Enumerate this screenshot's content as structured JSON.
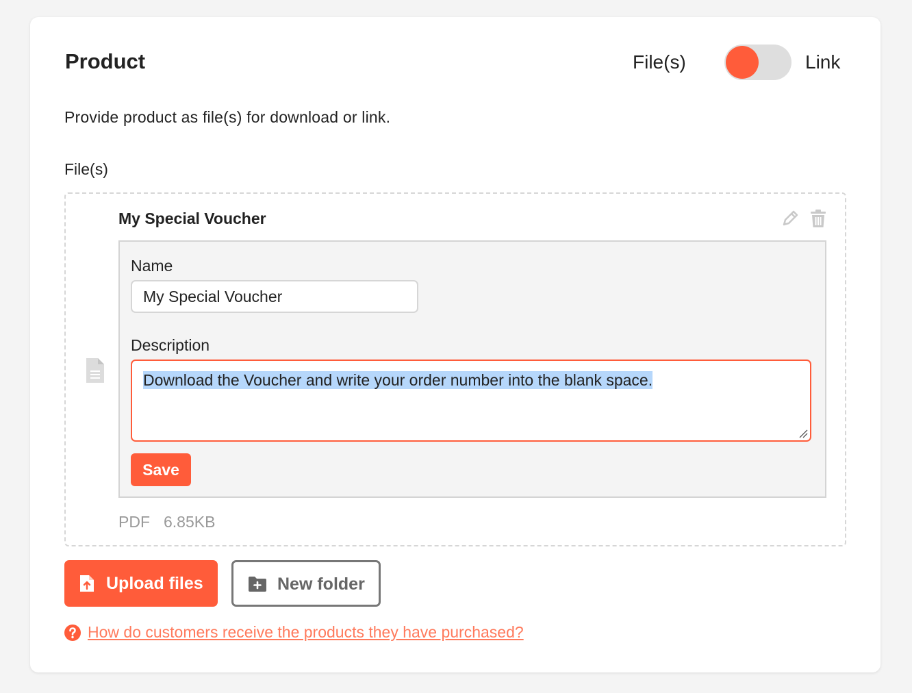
{
  "section": {
    "title": "Product",
    "description": "Provide product as file(s) for download or link.",
    "toggle": {
      "left_label": "File(s)",
      "right_label": "Link",
      "selected": "File(s)",
      "accent_color": "#ff5c3a"
    },
    "files_label": "File(s)"
  },
  "file": {
    "title": "My Special Voucher",
    "icon": "document-icon",
    "actions": {
      "edit_icon": "pencil-icon",
      "delete_icon": "trash-icon"
    },
    "form": {
      "name_label": "Name",
      "name_value": "My Special Voucher",
      "description_label": "Description",
      "description_value": "Download the Voucher and write your order number into the blank space.",
      "save_label": "Save"
    },
    "type": "PDF",
    "size": "6.85KB"
  },
  "buttons": {
    "upload_label": "Upload files",
    "upload_icon": "file-upload-icon",
    "new_folder_label": "New folder",
    "new_folder_icon": "folder-plus-icon"
  },
  "help": {
    "icon": "question-circle-icon",
    "link_text": "How do customers receive the products they have purchased?"
  }
}
